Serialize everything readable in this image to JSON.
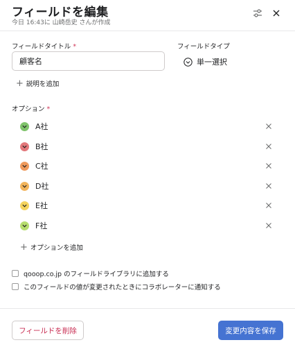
{
  "header": {
    "title": "フィールドを編集",
    "subtitle": "今日 16:43に 山崎岳史 さんが作成"
  },
  "field_title": {
    "label": "フィールドタイトル",
    "required_mark": "*",
    "value": "顧客名"
  },
  "field_type": {
    "label": "フィールドタイプ",
    "value": "単一選択"
  },
  "add_description": "説明を追加",
  "options_section": {
    "label": "オプション",
    "required_mark": "*",
    "items": [
      {
        "label": "A社",
        "color": "#7fc36b"
      },
      {
        "label": "B社",
        "color": "#e2777a"
      },
      {
        "label": "C社",
        "color": "#ef9a5c"
      },
      {
        "label": "D社",
        "color": "#f2b45b"
      },
      {
        "label": "E社",
        "color": "#f4d35e"
      },
      {
        "label": "F社",
        "color": "#b6dd6e"
      }
    ],
    "add_label": "オプションを追加"
  },
  "checkboxes": [
    {
      "label": "qooop.co.jp のフィールドライブラリに追加する",
      "checked": false
    },
    {
      "label": "このフィールドの値が変更されたときにコラボレーターに通知する",
      "checked": false
    }
  ],
  "footer": {
    "delete_label": "フィールドを削除",
    "save_label": "変更内容を保存"
  },
  "icons": {
    "settings": "sliders-icon",
    "close": "close-icon",
    "field_type": "chevron-circle-icon",
    "option_dot": "chevron-down-icon",
    "remove": "close-icon"
  }
}
